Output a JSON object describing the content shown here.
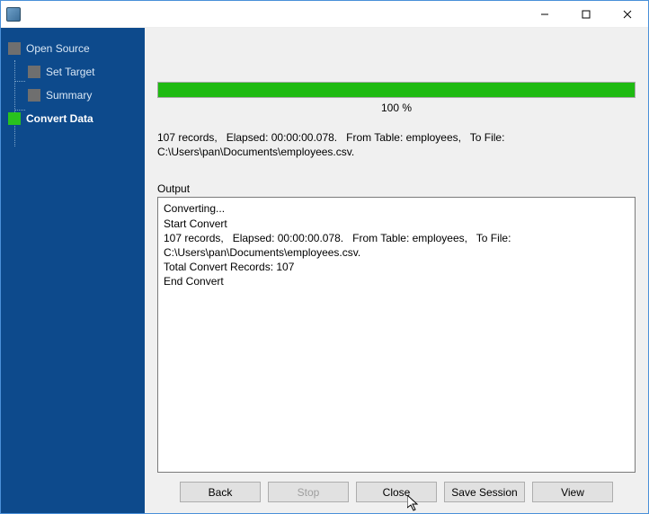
{
  "window": {
    "title": ""
  },
  "sidebar": {
    "items": [
      {
        "label": "Open Source"
      },
      {
        "label": "Set Target"
      },
      {
        "label": "Summary"
      },
      {
        "label": "Convert Data"
      }
    ]
  },
  "progress": {
    "percent_label": "100 %",
    "percent_value": 100
  },
  "status": "107 records,   Elapsed: 00:00:00.078.   From Table: employees,   To File: C:\\Users\\pan\\Documents\\employees.csv.",
  "output": {
    "label": "Output",
    "text": "Converting...\nStart Convert\n107 records,   Elapsed: 00:00:00.078.   From Table: employees,   To File: C:\\Users\\pan\\Documents\\employees.csv.\nTotal Convert Records: 107\nEnd Convert"
  },
  "buttons": {
    "back": "Back",
    "stop": "Stop",
    "close": "Close",
    "save_session": "Save Session",
    "view": "View"
  }
}
